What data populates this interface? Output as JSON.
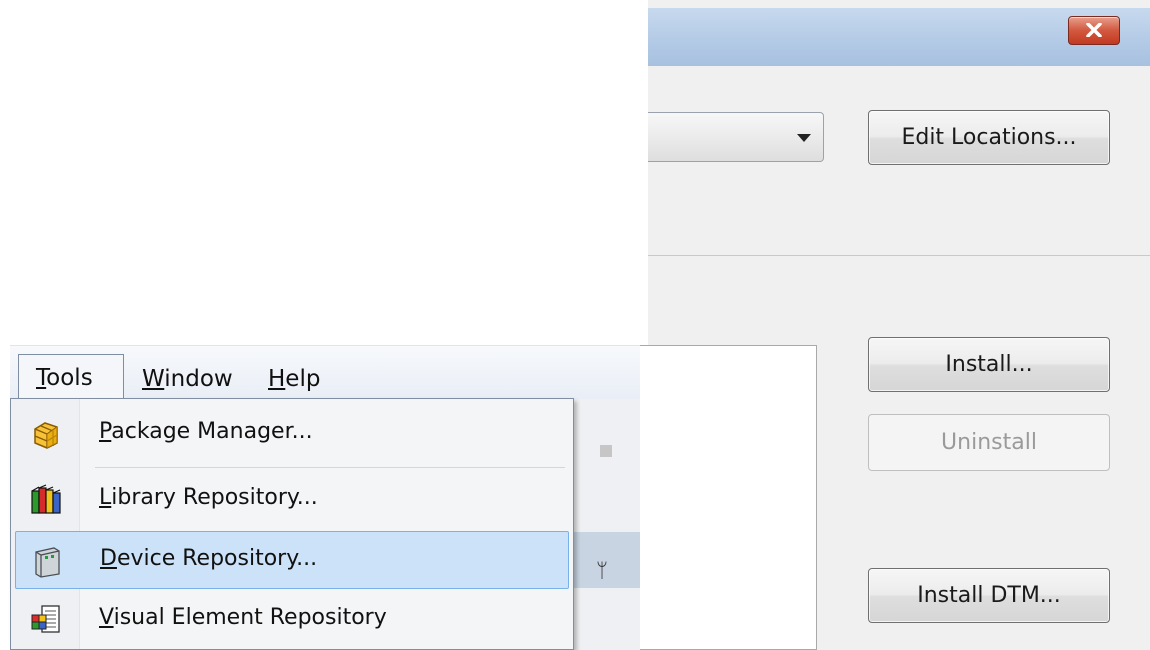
{
  "dialog": {
    "close_icon": "close-icon",
    "buttons": {
      "edit_locations": "Edit Locations...",
      "install": "Install...",
      "uninstall": "Uninstall",
      "install_dtm": "Install DTM..."
    }
  },
  "menubar": {
    "tools": {
      "underline": "T",
      "rest": "ools"
    },
    "window": {
      "underline": "W",
      "rest": "indow"
    },
    "help": {
      "underline": "H",
      "rest": "elp"
    }
  },
  "tools_menu": {
    "items": [
      {
        "underline": "P",
        "rest": "ackage Manager...",
        "icon": "package-manager-icon"
      },
      {
        "underline": "L",
        "rest": "ibrary Repository...",
        "icon": "library-repository-icon"
      },
      {
        "underline": "D",
        "rest": "evice Repository...",
        "icon": "device-repository-icon",
        "highlighted": true
      },
      {
        "underline": "V",
        "rest": "isual Element Repository",
        "icon": "visual-element-repository-icon"
      }
    ]
  },
  "behind": {
    "pin_glyph": "ᛘ"
  },
  "colors": {
    "highlight": "#cce2f8",
    "titlebar": "#b4cbe6",
    "close_button": "#c13b20"
  }
}
